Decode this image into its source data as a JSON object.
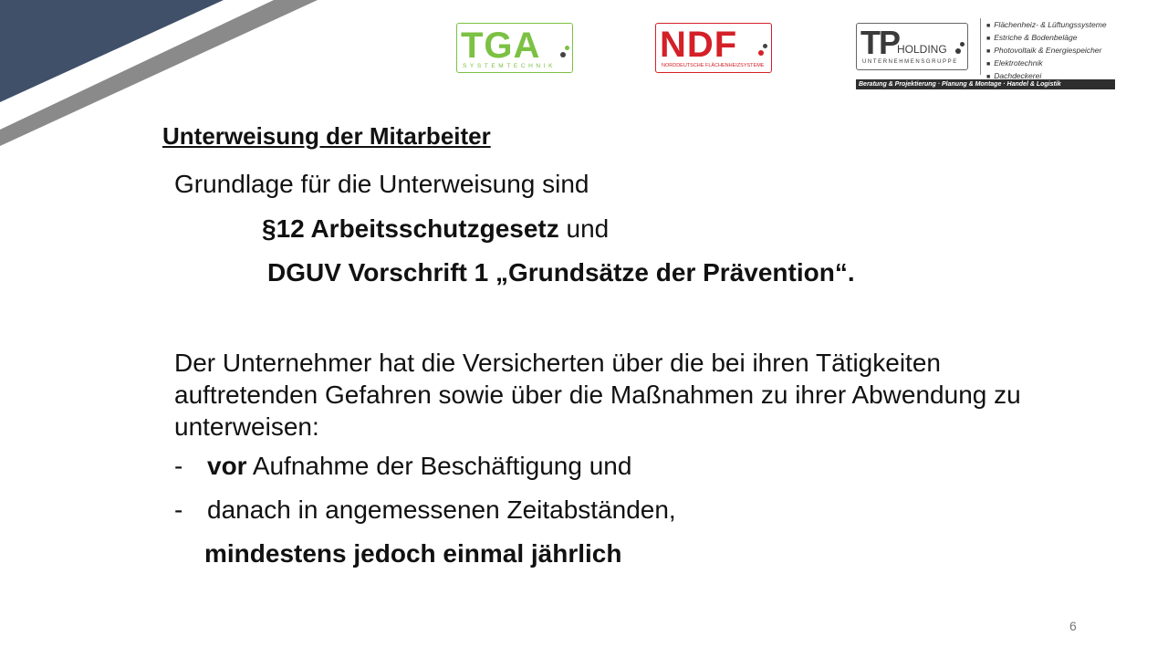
{
  "logos": {
    "tga": {
      "name": "TGA",
      "subtitle": "SYSTEMTECHNIK"
    },
    "ndf": {
      "name": "NDF",
      "subtitle": "NORDDEUTSCHE FLÄCHENHEIZSYSTEME"
    },
    "tp": {
      "name": "TP",
      "holding": "HOLDING",
      "subtitle": "UNTERNEHMENSGRUPPE"
    },
    "services": [
      "Flächenheiz- & Lüftungssysteme",
      "Estriche & Bodenbeläge",
      "Photovoltaik & Energiespeicher",
      "Elektrotechnik",
      "Dachdeckerei"
    ],
    "tagline": "Beratung & Projektierung · Planung & Montage · Handel & Logistik"
  },
  "slide": {
    "heading": "Unterweisung der Mitarbeiter",
    "intro": "Grundlage für die Unterweisung sind",
    "law1_bold": "§12 Arbeitsschutzgesetz",
    "law1_rest": " und",
    "law2": "DGUV Vorschrift 1 „Grundsätze der Prävention“.",
    "paragraph": "Der Unternehmer hat die Versicherten über die bei ihren Tätigkeiten auftretenden Gefahren sowie über die Maßnahmen zu ihrer Abwendung zu unterweisen:",
    "bullets": [
      {
        "dash": "-",
        "bold": "vor",
        "rest": " Aufnahme der Beschäftigung und"
      },
      {
        "dash": "-",
        "bold": "",
        "rest": "danach in angemessenen Zeitabständen,"
      }
    ],
    "closing": "mindestens jedoch einmal jährlich",
    "page_number": "6"
  },
  "colors": {
    "navy": "#3f5068",
    "grey_stripe": "#8a8a8a",
    "tga_green": "#7bc143",
    "ndf_red": "#d42027"
  }
}
